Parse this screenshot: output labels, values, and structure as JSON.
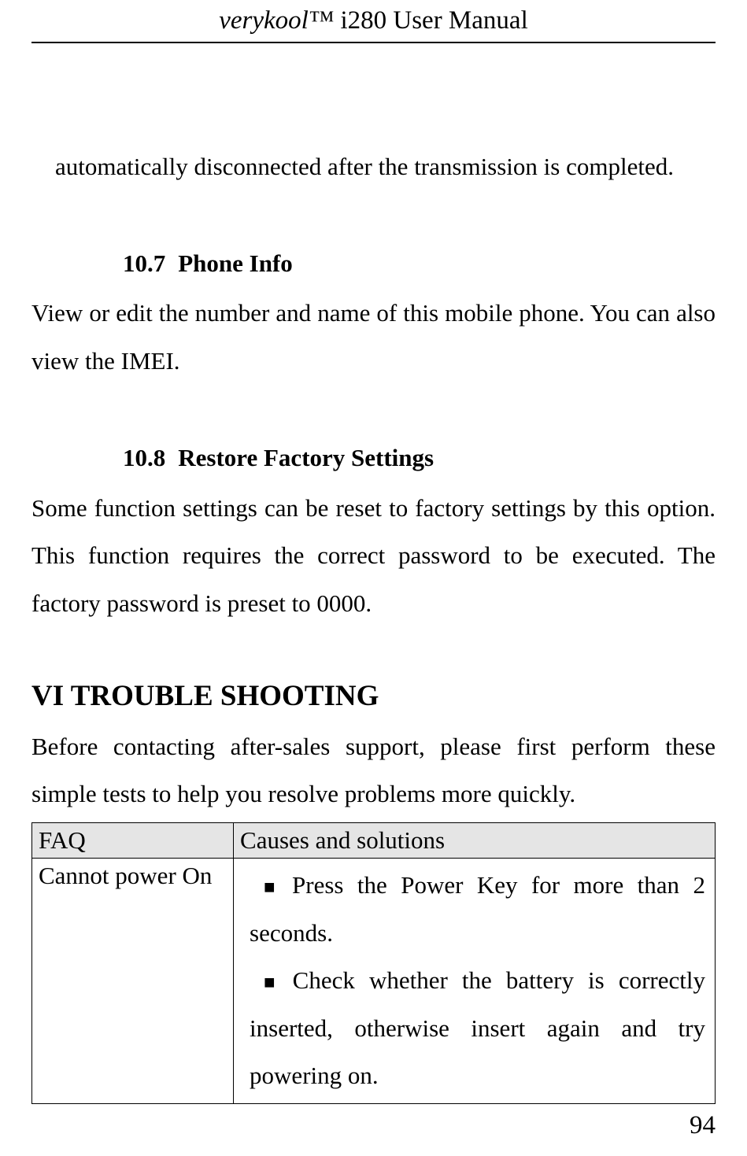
{
  "header": {
    "brand": "verykool™",
    "title_rest": " i280 User Manual"
  },
  "intro_line": "automatically disconnected after the transmission is completed.",
  "sections": {
    "phone_info": {
      "number": "10.7",
      "title": "Phone Info",
      "body": "View or edit the number and name of this mobile phone. You can also view the IMEI."
    },
    "restore": {
      "number": "10.8",
      "title": "Restore Factory Settings",
      "body": "Some function settings can be reset to factory settings by this option. This function requires the correct password to be executed. The factory password is preset to 0000."
    }
  },
  "chapter": {
    "title": "VI TROUBLE SHOOTING",
    "body": "Before contacting after-sales support, please first perform these simple tests to help you resolve problems more quickly."
  },
  "table": {
    "headers": {
      "faq": "FAQ",
      "solutions": "Causes and solutions"
    },
    "rows": [
      {
        "faq": "Cannot power On",
        "bullets": [
          "Press the Power Key for more than 2 seconds.",
          "Check whether the battery is correctly inserted, otherwise insert again and try powering on."
        ]
      }
    ]
  },
  "page_number": "94",
  "bullet_char": "■"
}
